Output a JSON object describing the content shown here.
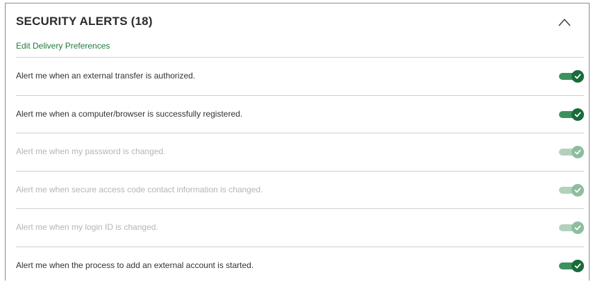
{
  "section": {
    "title": "SECURITY ALERTS (18)",
    "edit_link": "Edit Delivery Preferences"
  },
  "colors": {
    "accent": "#1a6b3a",
    "link": "#1f7a3c",
    "disabled_text": "#b5b5b5"
  },
  "icons": {
    "collapse": "chevron-up-icon",
    "toggle_check": "check-icon"
  },
  "alerts": [
    {
      "label": "Alert me when an external transfer is authorized.",
      "enabled": true,
      "disabled": false
    },
    {
      "label": "Alert me when a computer/browser is successfully registered.",
      "enabled": true,
      "disabled": false
    },
    {
      "label": "Alert me when my password is changed.",
      "enabled": true,
      "disabled": true
    },
    {
      "label": "Alert me when secure access code contact information is changed.",
      "enabled": true,
      "disabled": true
    },
    {
      "label": "Alert me when my login ID is changed.",
      "enabled": true,
      "disabled": true
    },
    {
      "label": "Alert me when the process to add an external account is started.",
      "enabled": true,
      "disabled": false
    }
  ]
}
